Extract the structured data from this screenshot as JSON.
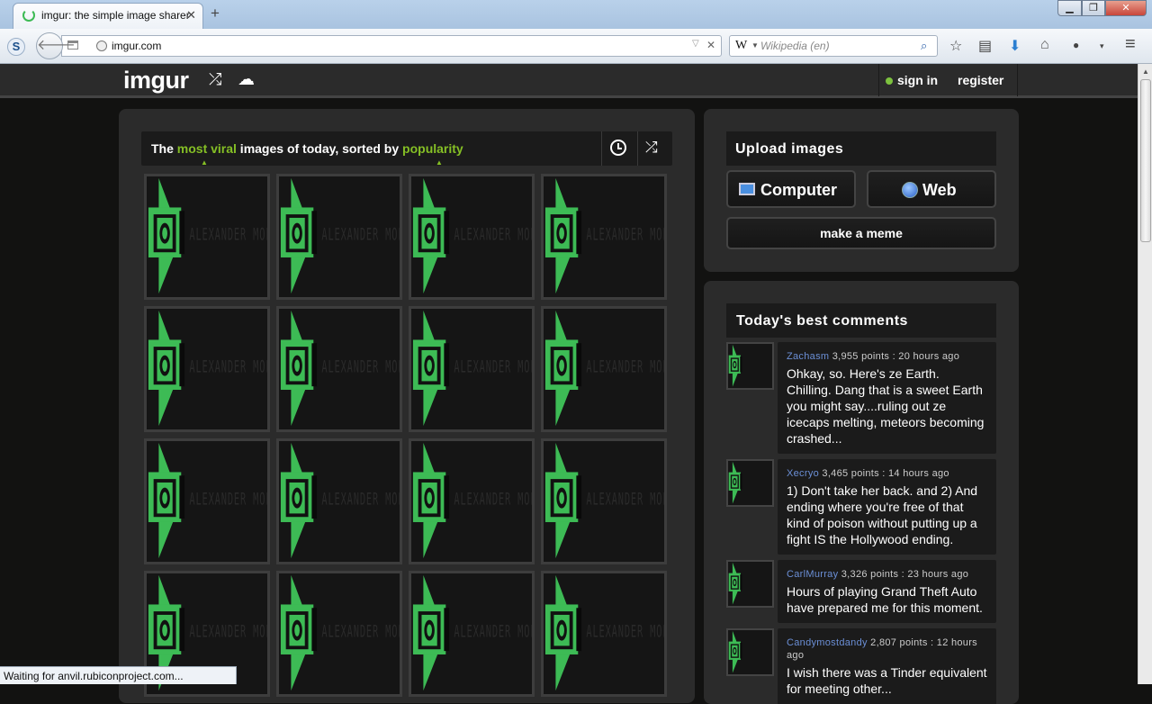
{
  "browser": {
    "tab_title": "imgur: the simple image sharer",
    "tab_close": "✕",
    "new_tab": "+",
    "url": "imgur.com",
    "search_placeholder": "Wikipedia (en)",
    "search_engine_glyph": "W",
    "status": "Waiting for anvil.rubiconproject.com..."
  },
  "header": {
    "logo": "imgur",
    "sign_in": "sign in",
    "register": "register",
    "status_color": "#7dc23f"
  },
  "gallery": {
    "sort_prefix": "The ",
    "sort_sort": "most viral",
    "sort_mid": " images of today, sorted by ",
    "sort_by": "popularity",
    "accent_color": "#85bf25",
    "thumbnail_count": 16,
    "thumbnail_logo_text": "ALEXANDER MOFFITT"
  },
  "upload": {
    "title": "Upload images",
    "computer": "Computer",
    "web": "Web",
    "meme": "make a meme"
  },
  "comments": {
    "title": "Today's best comments",
    "items": [
      {
        "user": "Zachasm",
        "meta": " 3,955 points : 20 hours ago",
        "text": "Ohkay, so. Here's ze Earth. Chilling. Dang that is a sweet Earth you might say....ruling out ze icecaps melting, meteors becoming crashed..."
      },
      {
        "user": "Xecryo",
        "meta": " 3,465 points : 14 hours ago",
        "text": "1) Don't take her back. and 2) And ending where you're free of that kind of poison without putting up a fight IS the Hollywood ending."
      },
      {
        "user": "CarlMurray",
        "meta": " 3,326 points : 23 hours ago",
        "text": "Hours of playing Grand Theft Auto have prepared me for this moment."
      },
      {
        "user": "Candymostdandy",
        "meta": " 2,807 points : 12 hours ago",
        "text": "I wish there was a Tinder equivalent for meeting other..."
      }
    ]
  }
}
